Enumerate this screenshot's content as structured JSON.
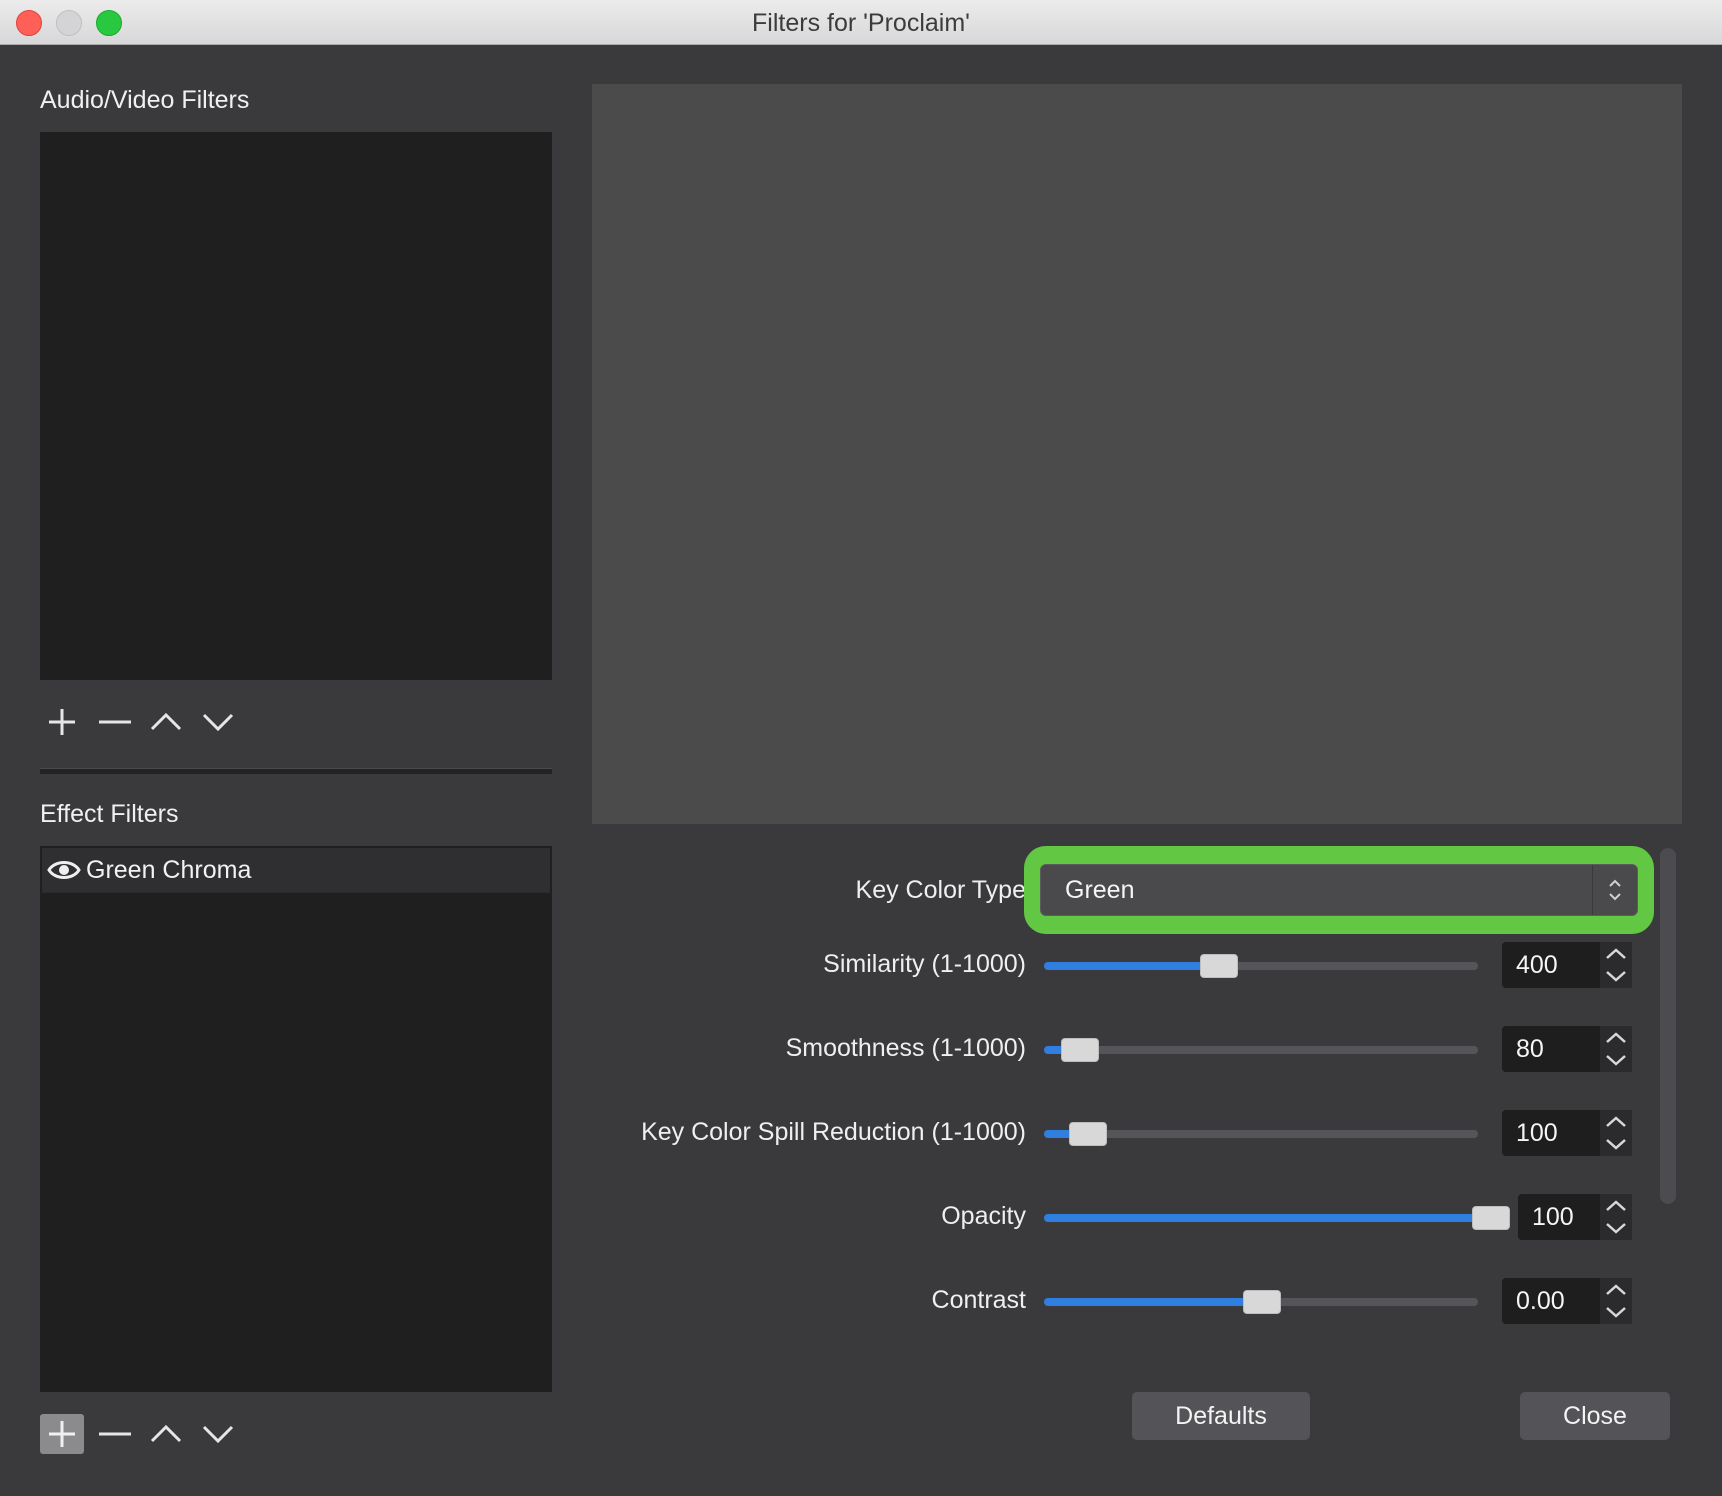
{
  "window": {
    "title": "Filters for 'Proclaim'"
  },
  "audio_video": {
    "title": "Audio/Video Filters"
  },
  "effect": {
    "title": "Effect Filters",
    "items": [
      {
        "label": "Green Chroma",
        "icon": "eye-icon"
      }
    ]
  },
  "properties": {
    "key_color_type": {
      "label": "Key Color Type",
      "value": "Green"
    },
    "similarity": {
      "label": "Similarity (1-1000)",
      "value": "400",
      "fraction": 0.4
    },
    "smoothness": {
      "label": "Smoothness (1-1000)",
      "value": "80",
      "fraction": 0.08
    },
    "spill": {
      "label": "Key Color Spill Reduction (1-1000)",
      "value": "100",
      "fraction": 0.1
    },
    "opacity": {
      "label": "Opacity",
      "value": "100",
      "fraction": 1.0
    },
    "contrast": {
      "label": "Contrast",
      "value": "0.00",
      "fraction": 0.5
    }
  },
  "buttons": {
    "defaults": "Defaults",
    "close": "Close"
  },
  "colors": {
    "accent": "#2f7fe0",
    "highlight": "#62c844",
    "background": "#3a393c"
  }
}
